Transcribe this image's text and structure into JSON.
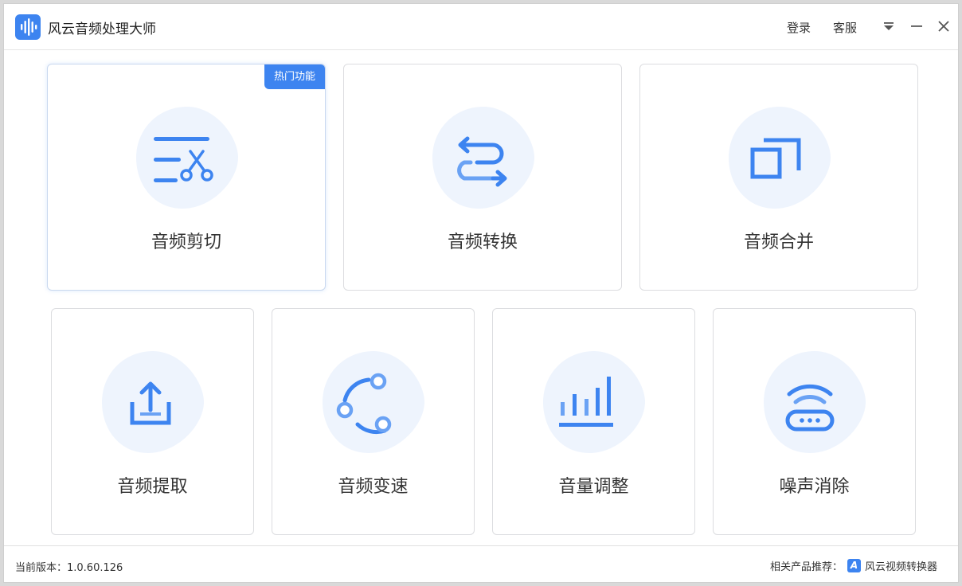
{
  "app": {
    "title": "风云音频处理大师",
    "logo_icon": "audio-wave-icon",
    "accent_color": "#3d84f0"
  },
  "titlebar": {
    "login": "登录",
    "service": "客服",
    "menu_icon": "dropdown-menu-icon",
    "minimize_icon": "minimize-icon",
    "close_icon": "close-icon"
  },
  "cards": {
    "cut": {
      "label": "音频剪切",
      "icon": "audio-cut-icon",
      "badge": "热门功能"
    },
    "convert": {
      "label": "音频转换",
      "icon": "convert-arrows-icon"
    },
    "merge": {
      "label": "音频合并",
      "icon": "merge-icon"
    },
    "extract": {
      "label": "音频提取",
      "icon": "extract-upload-icon"
    },
    "speed": {
      "label": "音频变速",
      "icon": "speed-change-icon"
    },
    "volume": {
      "label": "音量调整",
      "icon": "volume-bars-icon"
    },
    "denoise": {
      "label": "噪声消除",
      "icon": "noise-reduction-icon"
    }
  },
  "footer": {
    "version_label": "当前版本：1.0.60.126",
    "related_label": "相关产品推荐：",
    "related_icon_letter": "A",
    "related_product": "风云视频转换器"
  }
}
